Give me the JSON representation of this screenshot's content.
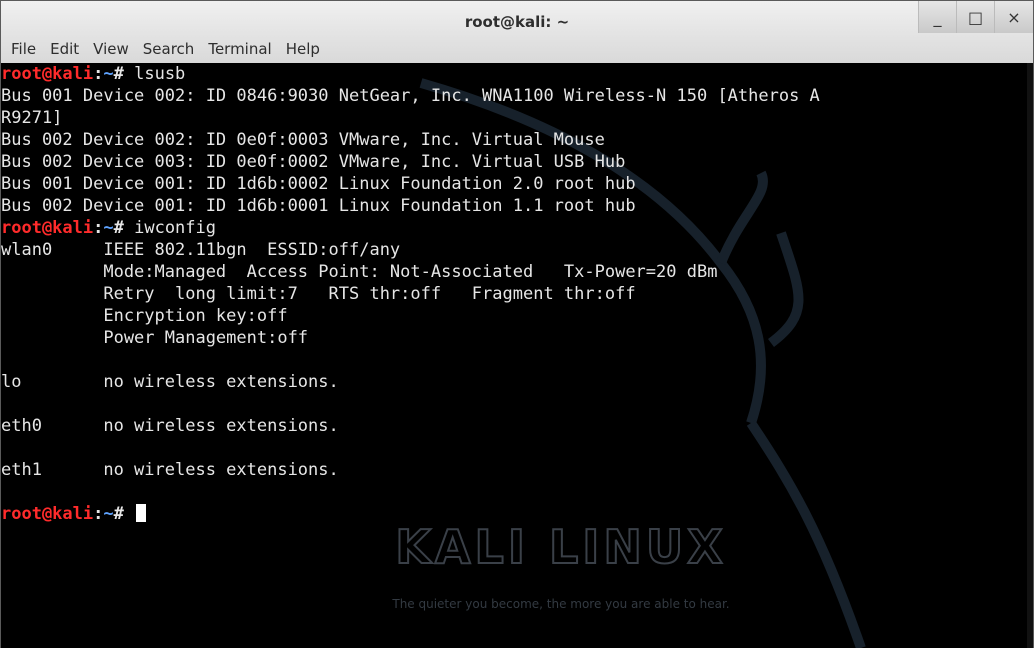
{
  "window": {
    "title": "root@kali: ~",
    "buttons": {
      "minimize": "_",
      "maximize": "□",
      "close": "×"
    }
  },
  "menu": [
    "File",
    "Edit",
    "View",
    "Search",
    "Terminal",
    "Help"
  ],
  "prompt": {
    "user": "root@kali",
    "sep": ":",
    "path": "~",
    "sym": "# "
  },
  "session": [
    {
      "type": "cmd",
      "text": "lsusb"
    },
    {
      "type": "out",
      "text": "Bus 001 Device 002: ID 0846:9030 NetGear, Inc. WNA1100 Wireless-N 150 [Atheros A"
    },
    {
      "type": "out",
      "text": "R9271]"
    },
    {
      "type": "out",
      "text": "Bus 002 Device 002: ID 0e0f:0003 VMware, Inc. Virtual Mouse"
    },
    {
      "type": "out",
      "text": "Bus 002 Device 003: ID 0e0f:0002 VMware, Inc. Virtual USB Hub"
    },
    {
      "type": "out",
      "text": "Bus 001 Device 001: ID 1d6b:0002 Linux Foundation 2.0 root hub"
    },
    {
      "type": "out",
      "text": "Bus 002 Device 001: ID 1d6b:0001 Linux Foundation 1.1 root hub"
    },
    {
      "type": "cmd",
      "text": "iwconfig"
    },
    {
      "type": "out",
      "text": "wlan0     IEEE 802.11bgn  ESSID:off/any"
    },
    {
      "type": "out",
      "text": "          Mode:Managed  Access Point: Not-Associated   Tx-Power=20 dBm"
    },
    {
      "type": "out",
      "text": "          Retry  long limit:7   RTS thr:off   Fragment thr:off"
    },
    {
      "type": "out",
      "text": "          Encryption key:off"
    },
    {
      "type": "out",
      "text": "          Power Management:off"
    },
    {
      "type": "out",
      "text": ""
    },
    {
      "type": "out",
      "text": "lo        no wireless extensions."
    },
    {
      "type": "out",
      "text": ""
    },
    {
      "type": "out",
      "text": "eth0      no wireless extensions."
    },
    {
      "type": "out",
      "text": ""
    },
    {
      "type": "out",
      "text": "eth1      no wireless extensions."
    },
    {
      "type": "out",
      "text": ""
    },
    {
      "type": "cursor",
      "text": ""
    }
  ],
  "watermark": {
    "brand": "KALI LINUX",
    "tagline": "The quieter you become, the more you are able to hear."
  },
  "colors": {
    "prompt_user": "#ff2b2b",
    "prompt_path": "#5fa3ff",
    "text": "#e6e6e6",
    "background": "#000000"
  }
}
